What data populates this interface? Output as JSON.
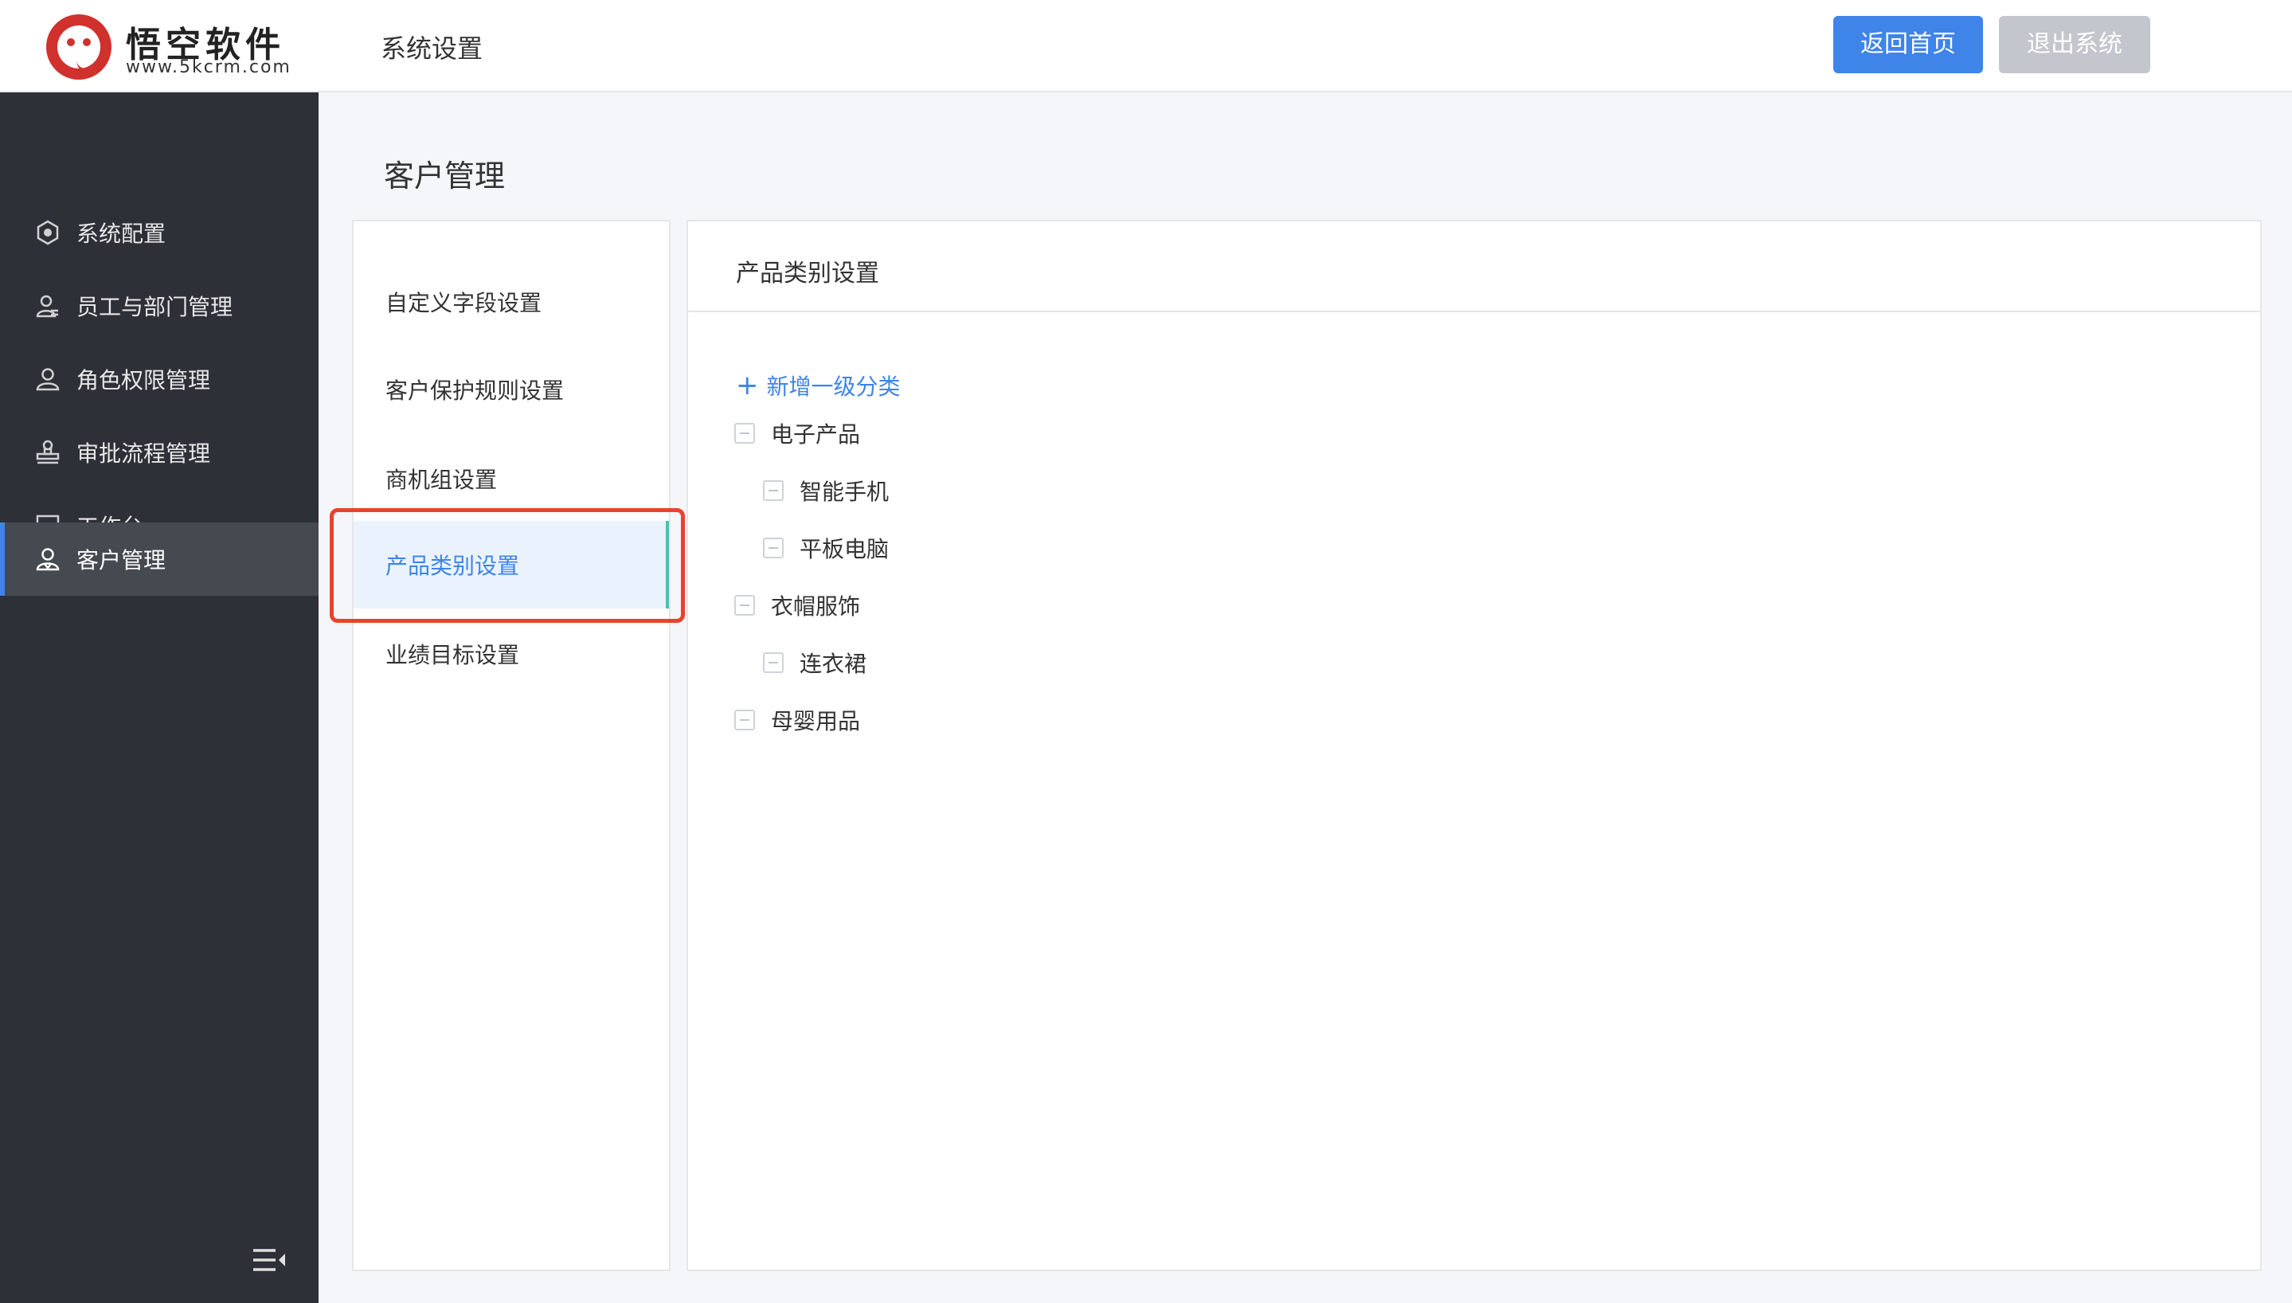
{
  "header": {
    "brand_name": "悟空软件",
    "brand_url": "www.5kcrm.com",
    "section_title": "系统设置",
    "home_button": "返回首页",
    "logout_button": "退出系统"
  },
  "sidebar": {
    "items": [
      {
        "label": "系统配置",
        "icon": "gear-hexagon-icon"
      },
      {
        "label": "员工与部门管理",
        "icon": "users-icon"
      },
      {
        "label": "角色权限管理",
        "icon": "user-icon"
      },
      {
        "label": "审批流程管理",
        "icon": "stamp-icon"
      },
      {
        "label": "工作台",
        "icon": "monitor-icon"
      },
      {
        "label": "客户管理",
        "icon": "customer-icon",
        "active": true
      }
    ],
    "collapse_icon": "collapse-menu-icon"
  },
  "page": {
    "title": "客户管理"
  },
  "subnav": {
    "items": [
      {
        "label": "自定义字段设置"
      },
      {
        "label": "客户保护规则设置"
      },
      {
        "label": "商机组设置"
      },
      {
        "label": "产品类别设置",
        "active": true
      },
      {
        "label": "业绩目标设置"
      }
    ]
  },
  "content": {
    "title": "产品类别设置",
    "add_label": "新增一级分类",
    "tree": [
      {
        "label": "电子产品",
        "level": 1
      },
      {
        "label": "智能手机",
        "level": 2
      },
      {
        "label": "平板电脑",
        "level": 2
      },
      {
        "label": "衣帽服饰",
        "level": 1
      },
      {
        "label": "连衣裙",
        "level": 2
      },
      {
        "label": "母婴用品",
        "level": 1
      }
    ]
  },
  "colors": {
    "primary": "#3e84e9",
    "sidebar_bg": "#2d3037",
    "highlight": "#e8432e",
    "disabled_button": "#c3c6cc"
  }
}
